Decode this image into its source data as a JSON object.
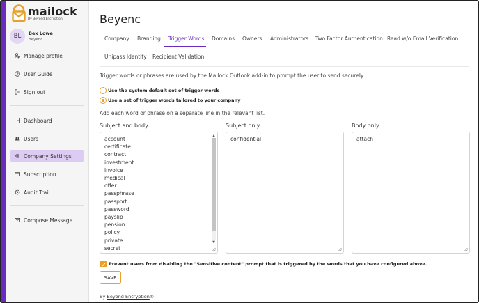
{
  "app": {
    "logo_name": "mailock",
    "logo_sub": "By Beyond Encryption"
  },
  "user": {
    "initials": "BL",
    "name": "Bex Lowe",
    "org": "Beyenc"
  },
  "sidebar": {
    "items": [
      {
        "label": "Manage profile",
        "icon": "person-gear-icon"
      },
      {
        "label": "User Guide",
        "icon": "question-icon"
      },
      {
        "label": "Sign out",
        "icon": "sign-out-icon"
      },
      {
        "label": "Dashboard",
        "icon": "dashboard-icon"
      },
      {
        "label": "Users",
        "icon": "users-icon"
      },
      {
        "label": "Company Settings",
        "icon": "gear-icon"
      },
      {
        "label": "Subscription",
        "icon": "card-icon"
      },
      {
        "label": "Audit Trail",
        "icon": "history-icon"
      },
      {
        "label": "Compose Message",
        "icon": "envelope-icon"
      }
    ]
  },
  "page": {
    "title": "Beyenc",
    "tabs": [
      {
        "label": "Company"
      },
      {
        "label": "Branding"
      },
      {
        "label": "Trigger Words"
      },
      {
        "label": "Domains"
      },
      {
        "label": "Owners"
      },
      {
        "label": "Administrators"
      },
      {
        "label": "Two Factor Authentication"
      },
      {
        "label": "Read w/o Email Verification"
      },
      {
        "label": "Unipass Identity"
      },
      {
        "label": "Recipient Validation"
      }
    ],
    "active_tab": "Trigger Words",
    "intro": "Trigger words or phrases are used by the Mailock Outlook add-in to prompt the user to send securely.",
    "radio_default": "Use the system default set of trigger words",
    "radio_custom": "Use a set of trigger words tailored to your company",
    "hint": "Add each word or phrase on a separate line in the relevant list.",
    "lists": {
      "subject_and_body": {
        "label": "Subject and body",
        "items": [
          "account",
          "certificate",
          "contract",
          "investment",
          "invoice",
          "medical",
          "offer",
          "passphrase",
          "passport",
          "password",
          "payslip",
          "pension",
          "policy",
          "private",
          "secret"
        ]
      },
      "subject_only": {
        "label": "Subject only",
        "items": [
          "confidential"
        ]
      },
      "body_only": {
        "label": "Body only",
        "items": [
          "attach"
        ]
      }
    },
    "prevent_label": "Prevent users from disabling the \"Sensitive content\" prompt that is triggered by the words that you have configured above.",
    "save_label": "SAVE",
    "footer_by": "By",
    "footer_link": "Beyond Encryption",
    "footer_mark": "®"
  },
  "colors": {
    "brand_purple": "#6a2bbf",
    "accent_orange": "#e8a02a",
    "active_nav_bg": "#dccbf2"
  }
}
